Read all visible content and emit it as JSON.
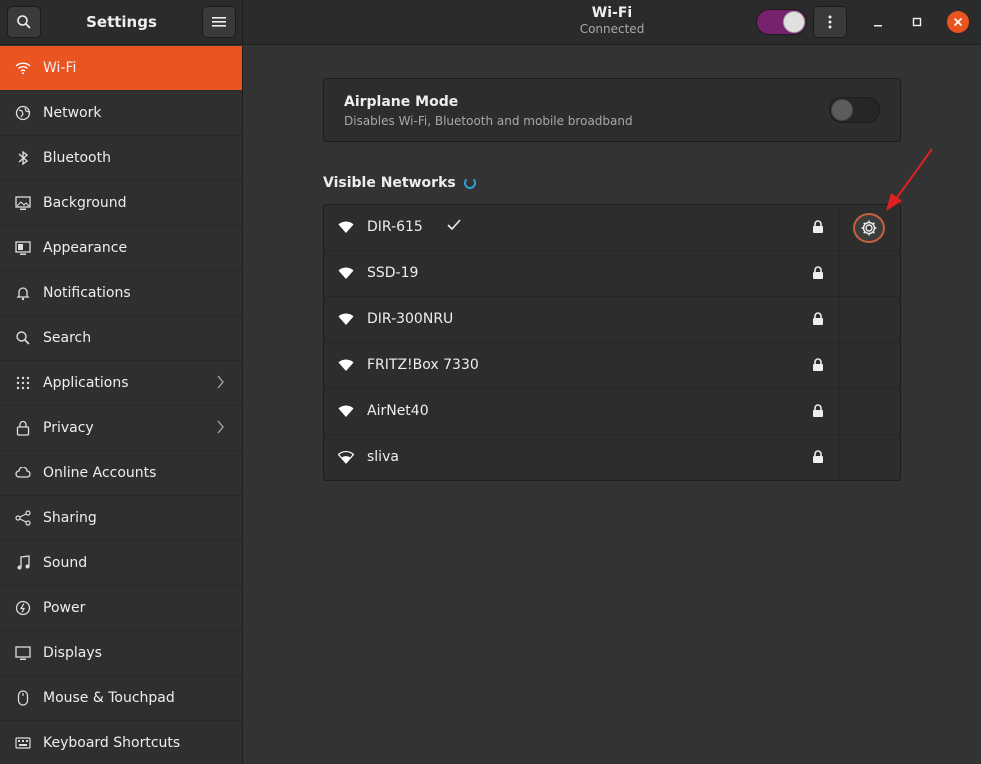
{
  "header": {
    "app_title": "Settings",
    "page_title": "Wi-Fi",
    "page_subtitle": "Connected",
    "wifi_enabled": true
  },
  "sidebar": {
    "items": [
      {
        "label": "Wi-Fi",
        "icon": "wifi-icon",
        "active": true
      },
      {
        "label": "Network",
        "icon": "network-globe-icon"
      },
      {
        "label": "Bluetooth",
        "icon": "bluetooth-icon"
      },
      {
        "label": "Background",
        "icon": "background-monitor-icon"
      },
      {
        "label": "Appearance",
        "icon": "appearance-icon"
      },
      {
        "label": "Notifications",
        "icon": "bell-icon"
      },
      {
        "label": "Search",
        "icon": "search-icon"
      },
      {
        "label": "Applications",
        "icon": "apps-grid-icon",
        "submenu": true
      },
      {
        "label": "Privacy",
        "icon": "lock-icon",
        "submenu": true
      },
      {
        "label": "Online Accounts",
        "icon": "cloud-icon"
      },
      {
        "label": "Sharing",
        "icon": "share-icon"
      },
      {
        "label": "Sound",
        "icon": "music-note-icon"
      },
      {
        "label": "Power",
        "icon": "power-icon"
      },
      {
        "label": "Displays",
        "icon": "display-icon"
      },
      {
        "label": "Mouse & Touchpad",
        "icon": "mouse-icon"
      },
      {
        "label": "Keyboard Shortcuts",
        "icon": "keyboard-icon"
      }
    ]
  },
  "airplane": {
    "title": "Airplane Mode",
    "subtitle": "Disables Wi-Fi, Bluetooth and mobile broadband",
    "enabled": false
  },
  "networks": {
    "heading": "Visible Networks",
    "items": [
      {
        "name": "DIR-615",
        "connected": true,
        "secured": true
      },
      {
        "name": "SSD-19",
        "secured": true
      },
      {
        "name": "DIR-300NRU",
        "secured": true
      },
      {
        "name": "FRITZ!Box 7330",
        "secured": true
      },
      {
        "name": "AirNet40",
        "secured": true
      },
      {
        "name": "sliva",
        "secured": true
      }
    ]
  },
  "colors": {
    "accent": "#e95420",
    "switch_on": "#77216f",
    "annotation_arrow": "#e02020"
  }
}
